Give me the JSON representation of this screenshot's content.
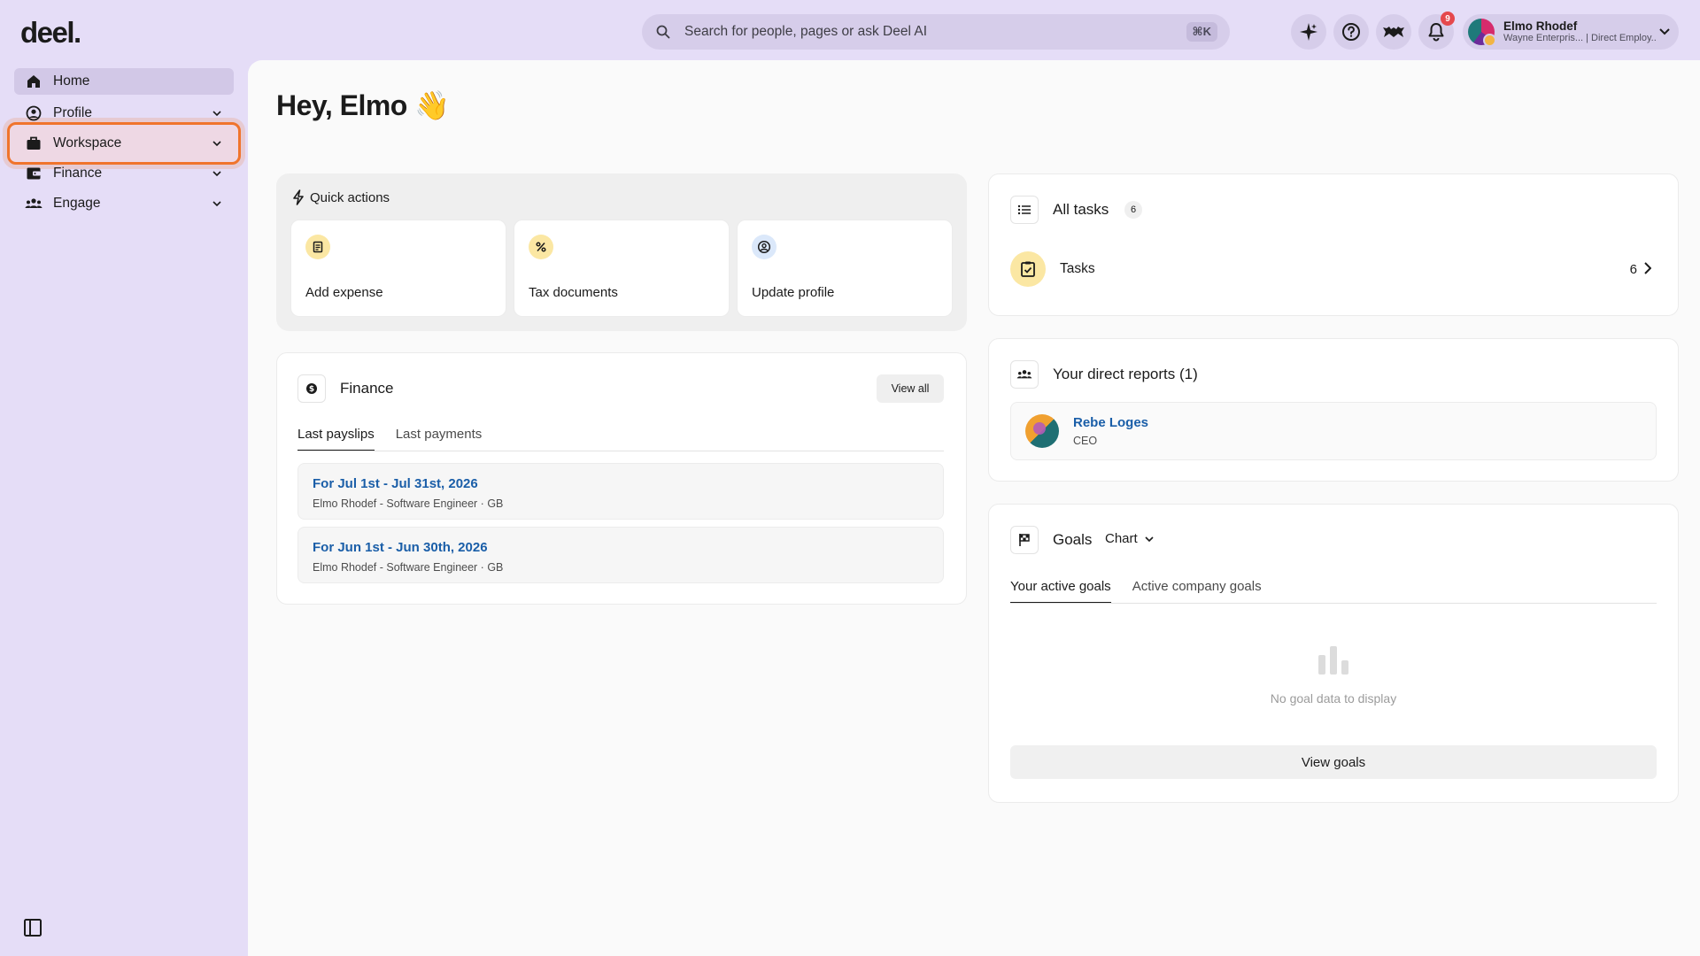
{
  "app": {
    "logo": "deel."
  },
  "topbar": {
    "search_placeholder": "Search for people, pages or ask Deel AI",
    "search_shortcut": "⌘K",
    "notification_count": "9",
    "user": {
      "name": "Elmo Rhodef",
      "subtitle": "Wayne Enterpris... | Direct Employ..."
    }
  },
  "sidebar": {
    "items": [
      {
        "label": "Home",
        "icon": "home-icon"
      },
      {
        "label": "Profile",
        "icon": "profile-icon"
      },
      {
        "label": "Workspace",
        "icon": "briefcase-icon"
      },
      {
        "label": "Finance",
        "icon": "wallet-icon"
      },
      {
        "label": "Engage",
        "icon": "people-icon"
      }
    ]
  },
  "greeting": "Hey, Elmo 👋",
  "quick_actions": {
    "title": "Quick actions",
    "items": [
      {
        "label": "Add expense",
        "icon": "receipt-icon",
        "color": "#fbe7a3"
      },
      {
        "label": "Tax documents",
        "icon": "percent-icon",
        "color": "#fbe7a3"
      },
      {
        "label": "Update profile",
        "icon": "user-circle-icon",
        "color": "#dbe8fa"
      }
    ]
  },
  "finance": {
    "title": "Finance",
    "view_all": "View all",
    "tabs": [
      "Last payslips",
      "Last payments"
    ],
    "payslips": [
      {
        "title": "For Jul 1st - Jul 31st, 2026",
        "sub": "Elmo Rhodef - Software Engineer · GB"
      },
      {
        "title": "For Jun 1st - Jun 30th, 2026",
        "sub": "Elmo Rhodef - Software Engineer · GB"
      }
    ]
  },
  "tasks": {
    "title": "All tasks",
    "count": "6",
    "row_label": "Tasks",
    "row_count": "6"
  },
  "reports": {
    "title": "Your direct reports (1)",
    "person": {
      "name": "Rebe Loges",
      "role": "CEO"
    }
  },
  "goals": {
    "title": "Goals",
    "view_mode": "Chart",
    "tabs": [
      "Your active goals",
      "Active company goals"
    ],
    "empty_text": "No goal data to display",
    "button": "View goals"
  },
  "colors": {
    "accent_link": "#1a5ea8",
    "highlight": "#f0742c",
    "sidebar_bg": "#e5ddf7"
  }
}
